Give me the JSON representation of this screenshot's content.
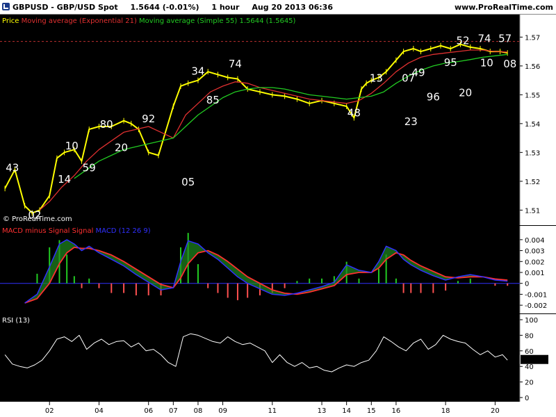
{
  "header": {
    "symbol": "GBPUSD - GBP/USD Spot",
    "quote": "1.5644 (-0.01%)",
    "timeframe": "1 hour",
    "datetime": "Aug 20 2013 06:36",
    "site": "www.ProRealTime.com"
  },
  "colors": {
    "price": "#ffff00",
    "ema21": "#e03030",
    "sma55": "#22cc22",
    "macd_line": "#3030ff",
    "signal_line": "#ff3030",
    "hist_pos": "#22cc22",
    "hist_neg": "#ff5050",
    "rsi": "#ffffff"
  },
  "chart_data": [
    {
      "type": "line",
      "panel": "price",
      "legend": [
        "Price",
        "Moving average (Exponential 21)",
        "Moving average (Simple 55)"
      ],
      "legend_values": "1.5644  (1.5645)",
      "watermark": "© ProRealTime.com",
      "ylim": [
        1.5055,
        1.5725
      ],
      "yticks": [
        "1.51",
        "1.52",
        "1.53",
        "1.54",
        "1.55",
        "1.56",
        "1.57"
      ],
      "resistance_level": 1.5685,
      "x_categories": [
        "02",
        "04",
        "06",
        "07",
        "08",
        "09",
        "11",
        "13",
        "14",
        "15",
        "16",
        "18",
        "20"
      ],
      "x_positions": [
        2,
        4,
        6,
        7,
        8,
        9,
        11,
        13,
        14,
        15,
        16,
        18,
        20
      ],
      "xlim": [
        0,
        21
      ],
      "series": [
        {
          "name": "Price",
          "x": [
            0.2,
            0.6,
            1.0,
            1.3,
            1.6,
            2.0,
            2.3,
            2.6,
            3.0,
            3.3,
            3.6,
            4.0,
            4.5,
            5.0,
            5.3,
            5.6,
            6.0,
            6.4,
            7.0,
            7.3,
            7.6,
            8.0,
            8.4,
            8.8,
            9.2,
            9.6,
            10.0,
            10.5,
            11.0,
            11.5,
            12.0,
            12.5,
            13.0,
            13.5,
            14.0,
            14.3,
            14.6,
            14.8,
            15.0,
            15.3,
            15.6,
            16.0,
            16.3,
            16.7,
            17.0,
            17.4,
            17.8,
            18.2,
            18.6,
            19.0,
            19.4,
            19.8,
            20.2,
            20.5
          ],
          "y": [
            1.5175,
            1.524,
            1.5115,
            1.509,
            1.51,
            1.515,
            1.528,
            1.53,
            1.531,
            1.527,
            1.538,
            1.539,
            1.539,
            1.541,
            1.54,
            1.538,
            1.53,
            1.529,
            1.546,
            1.553,
            1.554,
            1.555,
            1.558,
            1.557,
            1.556,
            1.5555,
            1.552,
            1.551,
            1.55,
            1.5495,
            1.5485,
            1.547,
            1.548,
            1.547,
            1.546,
            1.542,
            1.552,
            1.554,
            1.555,
            1.556,
            1.558,
            1.562,
            1.565,
            1.566,
            1.565,
            1.566,
            1.567,
            1.566,
            1.5675,
            1.5665,
            1.566,
            1.565,
            1.565,
            1.5645
          ]
        },
        {
          "name": "Moving average (Exponential 21)",
          "x": [
            1.6,
            2.0,
            2.5,
            3.0,
            3.5,
            4.0,
            4.5,
            5.0,
            5.5,
            6.0,
            6.5,
            7.0,
            7.5,
            8.0,
            8.5,
            9.0,
            9.5,
            10.0,
            10.5,
            11.0,
            11.5,
            12.0,
            12.5,
            13.0,
            13.5,
            14.0,
            14.5,
            15.0,
            15.5,
            16.0,
            16.5,
            17.0,
            17.5,
            18.0,
            18.5,
            19.0,
            19.5,
            20.0,
            20.5
          ],
          "y": [
            1.51,
            1.513,
            1.518,
            1.522,
            1.527,
            1.531,
            1.534,
            1.537,
            1.538,
            1.539,
            1.537,
            1.535,
            1.543,
            1.547,
            1.551,
            1.553,
            1.5545,
            1.554,
            1.5525,
            1.5515,
            1.5505,
            1.5495,
            1.5485,
            1.548,
            1.5475,
            1.547,
            1.548,
            1.5505,
            1.554,
            1.558,
            1.561,
            1.563,
            1.564,
            1.5645,
            1.565,
            1.5655,
            1.5655,
            1.565,
            1.5648
          ]
        },
        {
          "name": "Moving average (Simple 55)",
          "x": [
            3.0,
            3.5,
            4.0,
            4.5,
            5.0,
            5.5,
            6.0,
            6.5,
            7.0,
            7.5,
            8.0,
            8.5,
            9.0,
            9.5,
            10.0,
            10.5,
            11.0,
            11.5,
            12.0,
            12.5,
            13.0,
            13.5,
            14.0,
            14.5,
            15.0,
            15.5,
            16.0,
            16.5,
            17.0,
            17.5,
            18.0,
            18.5,
            19.0,
            19.5,
            20.0,
            20.5
          ],
          "y": [
            1.521,
            1.524,
            1.527,
            1.529,
            1.531,
            1.532,
            1.533,
            1.534,
            1.535,
            1.539,
            1.543,
            1.546,
            1.549,
            1.551,
            1.552,
            1.5525,
            1.5525,
            1.552,
            1.551,
            1.55,
            1.5495,
            1.549,
            1.5485,
            1.549,
            1.5495,
            1.551,
            1.554,
            1.5565,
            1.5585,
            1.56,
            1.561,
            1.5615,
            1.5622,
            1.563,
            1.5635,
            1.564
          ]
        }
      ],
      "annotations": [
        {
          "text": "43",
          "x": 0.5,
          "y": 1.5235
        },
        {
          "text": "02",
          "x": 1.4,
          "y": 1.5071
        },
        {
          "text": "14",
          "x": 2.6,
          "y": 1.5195
        },
        {
          "text": "10",
          "x": 2.9,
          "y": 1.531
        },
        {
          "text": "59",
          "x": 3.6,
          "y": 1.5235
        },
        {
          "text": "80",
          "x": 4.3,
          "y": 1.5385
        },
        {
          "text": "20",
          "x": 4.9,
          "y": 1.5305
        },
        {
          "text": "92",
          "x": 6.0,
          "y": 1.5405
        },
        {
          "text": "05",
          "x": 7.6,
          "y": 1.5185
        },
        {
          "text": "34",
          "x": 8.0,
          "y": 1.557
        },
        {
          "text": "85",
          "x": 8.6,
          "y": 1.547
        },
        {
          "text": "74",
          "x": 9.5,
          "y": 1.5595
        },
        {
          "text": "13",
          "x": 15.2,
          "y": 1.5545
        },
        {
          "text": "48",
          "x": 14.3,
          "y": 1.5425
        },
        {
          "text": "07",
          "x": 16.5,
          "y": 1.5545
        },
        {
          "text": "49",
          "x": 16.9,
          "y": 1.5565
        },
        {
          "text": "23",
          "x": 16.6,
          "y": 1.5395
        },
        {
          "text": "96",
          "x": 17.5,
          "y": 1.548
        },
        {
          "text": "95",
          "x": 18.2,
          "y": 1.56
        },
        {
          "text": "20",
          "x": 18.8,
          "y": 1.5495
        },
        {
          "text": "52",
          "x": 18.7,
          "y": 1.5675
        },
        {
          "text": "57",
          "x": 20.4,
          "y": 1.5683
        },
        {
          "text": "08",
          "x": 20.6,
          "y": 1.5595
        },
        {
          "text": "74",
          "x": 21.9,
          "y": 1.5683
        },
        {
          "text": "10",
          "x": 22.0,
          "y": 1.5598
        }
      ]
    },
    {
      "type": "line",
      "panel": "macd",
      "legend": [
        "MACD minus Signal Signal",
        "MACD (12 26 9)"
      ],
      "ylim": [
        -0.0025,
        0.0045
      ],
      "yticks": [
        "0.004",
        "0.003",
        "0.002",
        "0.001",
        "0",
        "-0.001",
        "-0.002"
      ],
      "xlim": [
        0,
        21
      ],
      "series": [
        {
          "name": "MACD",
          "x": [
            1.0,
            1.5,
            2.0,
            2.4,
            2.7,
            3.0,
            3.3,
            3.6,
            4.0,
            4.5,
            5.0,
            5.5,
            6.0,
            6.5,
            7.0,
            7.3,
            7.6,
            8.0,
            8.4,
            8.8,
            9.2,
            9.6,
            10.0,
            10.5,
            11.0,
            11.5,
            12.0,
            12.5,
            13.0,
            13.5,
            14.0,
            14.5,
            15.0,
            15.3,
            15.6,
            16.0,
            16.3,
            16.6,
            17.0,
            17.5,
            18.0,
            18.5,
            19.0,
            19.5,
            20.0,
            20.5
          ],
          "y": [
            -0.0018,
            -0.001,
            0.0015,
            0.0036,
            0.004,
            0.0036,
            0.003,
            0.0034,
            0.0028,
            0.0022,
            0.0016,
            0.0008,
            0.0001,
            -0.0006,
            -0.0004,
            0.002,
            0.0039,
            0.0036,
            0.0028,
            0.0022,
            0.0014,
            0.0006,
            0.0,
            -0.0005,
            -0.001,
            -0.0011,
            -0.0009,
            -0.0006,
            -0.0003,
            0.0001,
            0.0017,
            0.0012,
            0.001,
            0.002,
            0.0034,
            0.003,
            0.0022,
            0.0017,
            0.0012,
            0.0007,
            0.0003,
            0.0006,
            0.0008,
            0.0006,
            0.0003,
            0.0002
          ]
        },
        {
          "name": "Signal",
          "x": [
            1.0,
            1.5,
            2.0,
            2.4,
            2.7,
            3.0,
            3.3,
            3.6,
            4.0,
            4.5,
            5.0,
            5.5,
            6.0,
            6.5,
            7.0,
            7.3,
            7.6,
            8.0,
            8.4,
            8.8,
            9.2,
            9.6,
            10.0,
            10.5,
            11.0,
            11.5,
            12.0,
            12.5,
            13.0,
            13.5,
            14.0,
            14.5,
            15.0,
            15.3,
            15.6,
            16.0,
            16.3,
            16.6,
            17.0,
            17.5,
            18.0,
            18.5,
            19.0,
            19.5,
            20.0,
            20.5
          ],
          "y": [
            -0.0018,
            -0.0014,
            0.0,
            0.0018,
            0.0028,
            0.0033,
            0.0032,
            0.0032,
            0.003,
            0.0026,
            0.002,
            0.0013,
            0.0006,
            -0.0001,
            -0.0004,
            0.0005,
            0.0018,
            0.0028,
            0.003,
            0.0026,
            0.002,
            0.0013,
            0.0006,
            0.0,
            -0.0006,
            -0.0009,
            -0.001,
            -0.0008,
            -0.0005,
            -0.0002,
            0.0008,
            0.001,
            0.001,
            0.0014,
            0.0022,
            0.0028,
            0.0026,
            0.0021,
            0.0016,
            0.0011,
            0.0006,
            0.0005,
            0.0006,
            0.0006,
            0.0004,
            0.0003
          ]
        }
      ]
    },
    {
      "type": "line",
      "panel": "rsi",
      "legend": [
        "RSI (13)"
      ],
      "last_value": "48.471",
      "ylim": [
        0,
        100
      ],
      "yticks": [
        "100",
        "80",
        "60",
        "40",
        "20",
        "0"
      ],
      "xlim": [
        0,
        21
      ],
      "series": [
        {
          "name": "RSI",
          "x": [
            0.2,
            0.5,
            0.8,
            1.1,
            1.4,
            1.7,
            2.0,
            2.3,
            2.6,
            2.9,
            3.2,
            3.5,
            3.8,
            4.1,
            4.4,
            4.7,
            5.0,
            5.3,
            5.6,
            5.9,
            6.2,
            6.5,
            6.8,
            7.1,
            7.4,
            7.7,
            8.0,
            8.3,
            8.6,
            8.9,
            9.2,
            9.5,
            9.8,
            10.1,
            10.4,
            10.7,
            11.0,
            11.3,
            11.6,
            11.9,
            12.2,
            12.5,
            12.8,
            13.1,
            13.4,
            13.7,
            14.0,
            14.3,
            14.6,
            14.9,
            15.2,
            15.5,
            15.8,
            16.1,
            16.4,
            16.7,
            17.0,
            17.3,
            17.6,
            17.9,
            18.2,
            18.5,
            18.8,
            19.1,
            19.4,
            19.7,
            20.0,
            20.3,
            20.5
          ],
          "y": [
            55,
            43,
            40,
            38,
            42,
            48,
            60,
            75,
            78,
            72,
            80,
            62,
            70,
            75,
            68,
            72,
            73,
            65,
            70,
            60,
            62,
            55,
            45,
            40,
            78,
            82,
            80,
            76,
            72,
            70,
            78,
            72,
            68,
            70,
            65,
            60,
            45,
            55,
            45,
            40,
            45,
            38,
            40,
            35,
            33,
            38,
            42,
            40,
            45,
            48,
            60,
            78,
            72,
            65,
            60,
            70,
            75,
            62,
            68,
            80,
            75,
            72,
            70,
            62,
            55,
            60,
            52,
            55,
            48
          ]
        }
      ]
    }
  ]
}
